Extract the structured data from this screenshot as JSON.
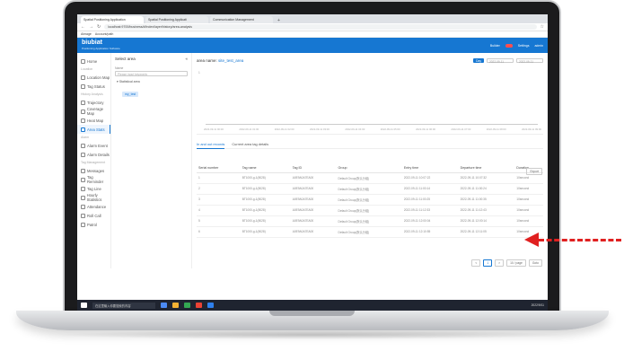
{
  "browser": {
    "tabs": [
      "Spatial Positioning Application",
      "Spatial Positioning Applicati",
      "Communication Management",
      "+"
    ],
    "url": "localhost:9700/business/#/index/layer/history/area-analysis",
    "bookmarks": [
      "Aimage",
      "Account/path"
    ]
  },
  "app": {
    "logo": "biubiat",
    "subtitle": "Positioning Application Software",
    "header_right": [
      "Builder",
      "Settings",
      "admin"
    ]
  },
  "sidebar": {
    "items": [
      {
        "group": "",
        "label": "Home"
      },
      {
        "group": "Location",
        "label": "Location Map"
      },
      {
        "group": "",
        "label": "Tag Status"
      },
      {
        "group": "History Analysis",
        "label": "Trajectory"
      },
      {
        "group": "",
        "label": "Coverage Map"
      },
      {
        "group": "",
        "label": "Heat Map"
      },
      {
        "group": "",
        "label": "Area Stats"
      },
      {
        "group": "Alarm",
        "label": "Alarm Event"
      },
      {
        "group": "",
        "label": "Alarm Details"
      },
      {
        "group": "Tag Management",
        "label": "Messages"
      },
      {
        "group": "",
        "label": "Tag Reminder"
      },
      {
        "group": "",
        "label": "Tag Line"
      },
      {
        "group": "",
        "label": "Hourly Statistics"
      },
      {
        "group": "",
        "label": "Attendance"
      },
      {
        "group": "",
        "label": "Roll Call"
      },
      {
        "group": "",
        "label": "Patrol"
      }
    ],
    "active_index": 6
  },
  "tree": {
    "title": "Select area",
    "label": "Name",
    "placeholder": "Please input keywords",
    "node": "Statistical area",
    "leaf": "my_test"
  },
  "content": {
    "area_label": "area name:",
    "area_value": "site_test_area",
    "filter_btn": "Day",
    "date_from": "2022-09-11",
    "date_to": "2022-09-11",
    "y_tick": "1",
    "x_labels": [
      "2022-09-11 00:00",
      "2022-09-11 01:00",
      "2022-09-11 02:00",
      "2022-09-11 03:00",
      "2022-09-11 04:00",
      "2022-09-11 05:00",
      "2022-09-11 06:00",
      "2022-09-11 07:00",
      "2022-09-11 08:00",
      "2022-09-11 09:00"
    ],
    "tabs": [
      "In and out records",
      "Current area tag details"
    ],
    "export": "Export",
    "columns": [
      "Serial number",
      "Tag name",
      "Tag ID",
      "Group",
      "Entry time",
      "Departure time",
      "Duration"
    ],
    "rows": [
      [
        "1",
        "BT1000-g-1(8028)",
        "A0E9A0A7EA00",
        "Default Group(默认分组)",
        "2022-09-11 10:07:22",
        "2022-09-11 10:07:32",
        "10second"
      ],
      [
        "2",
        "BT1000-g-1(8028)",
        "A0E9A0A7EA00",
        "Default Group(默认分组)",
        "2022-09-11 11:00:14",
        "2022-09-11 11:00:24",
        "10second"
      ],
      [
        "3",
        "BT1000-g-1(8028)",
        "A0E9A0A7EA00",
        "Default Group(默认分组)",
        "2022-09-11 11:00:25",
        "2022-09-11 11:00:35",
        "10second"
      ],
      [
        "4",
        "BT1000-g-1(8028)",
        "A0E9A0A7EA00",
        "Default Group(默认分组)",
        "2022-09-11 11:12:33",
        "2022-09-11 11:12:43",
        "10second"
      ],
      [
        "5",
        "BT1000-g-1(8028)",
        "A0E9A0A7EA00",
        "Default Group(默认分组)",
        "2022-09-11 12:00:04",
        "2022-09-11 12:00:14",
        "10second"
      ],
      [
        "6",
        "BT1000-g-1(8028)",
        "A0E9A0A7EA00",
        "Default Group(默认分组)",
        "2022-09-11 12:10:55",
        "2022-09-11 12:11:05",
        "10second"
      ]
    ],
    "pager": [
      "<",
      "1",
      ">",
      "10 / page",
      "Goto"
    ]
  },
  "taskbar": {
    "search": "在这里输入你要搜索的内容",
    "clock": "2022/9/11"
  },
  "colors": {
    "accent": "#1677d2",
    "arrow": "#e02020"
  }
}
